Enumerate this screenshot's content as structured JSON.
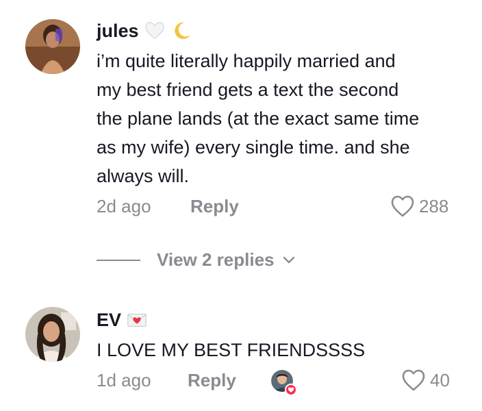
{
  "comments": [
    {
      "username": "jules",
      "badges": [
        "white-heart-icon",
        "crescent-moon-icon"
      ],
      "text_lines": [
        "i’m quite literally happily married and",
        "my best friend gets a text the second",
        "the plane lands (at the exact same time",
        "as my wife) every single time. and she",
        "always will."
      ],
      "time": "2d ago",
      "reply_label": "Reply",
      "likes": "288",
      "view_replies": "View 2 replies"
    },
    {
      "username": "EV",
      "badges": [
        "love-letter-icon"
      ],
      "text_lines": [
        "I LOVE MY BEST FRIENDSSSS"
      ],
      "time": "1d ago",
      "reply_label": "Reply",
      "likes": "40",
      "liked_by_creator": true
    }
  ],
  "colors": {
    "text": "#161823",
    "secondary": "#8a8b91",
    "like_accent": "#fe2c55"
  }
}
